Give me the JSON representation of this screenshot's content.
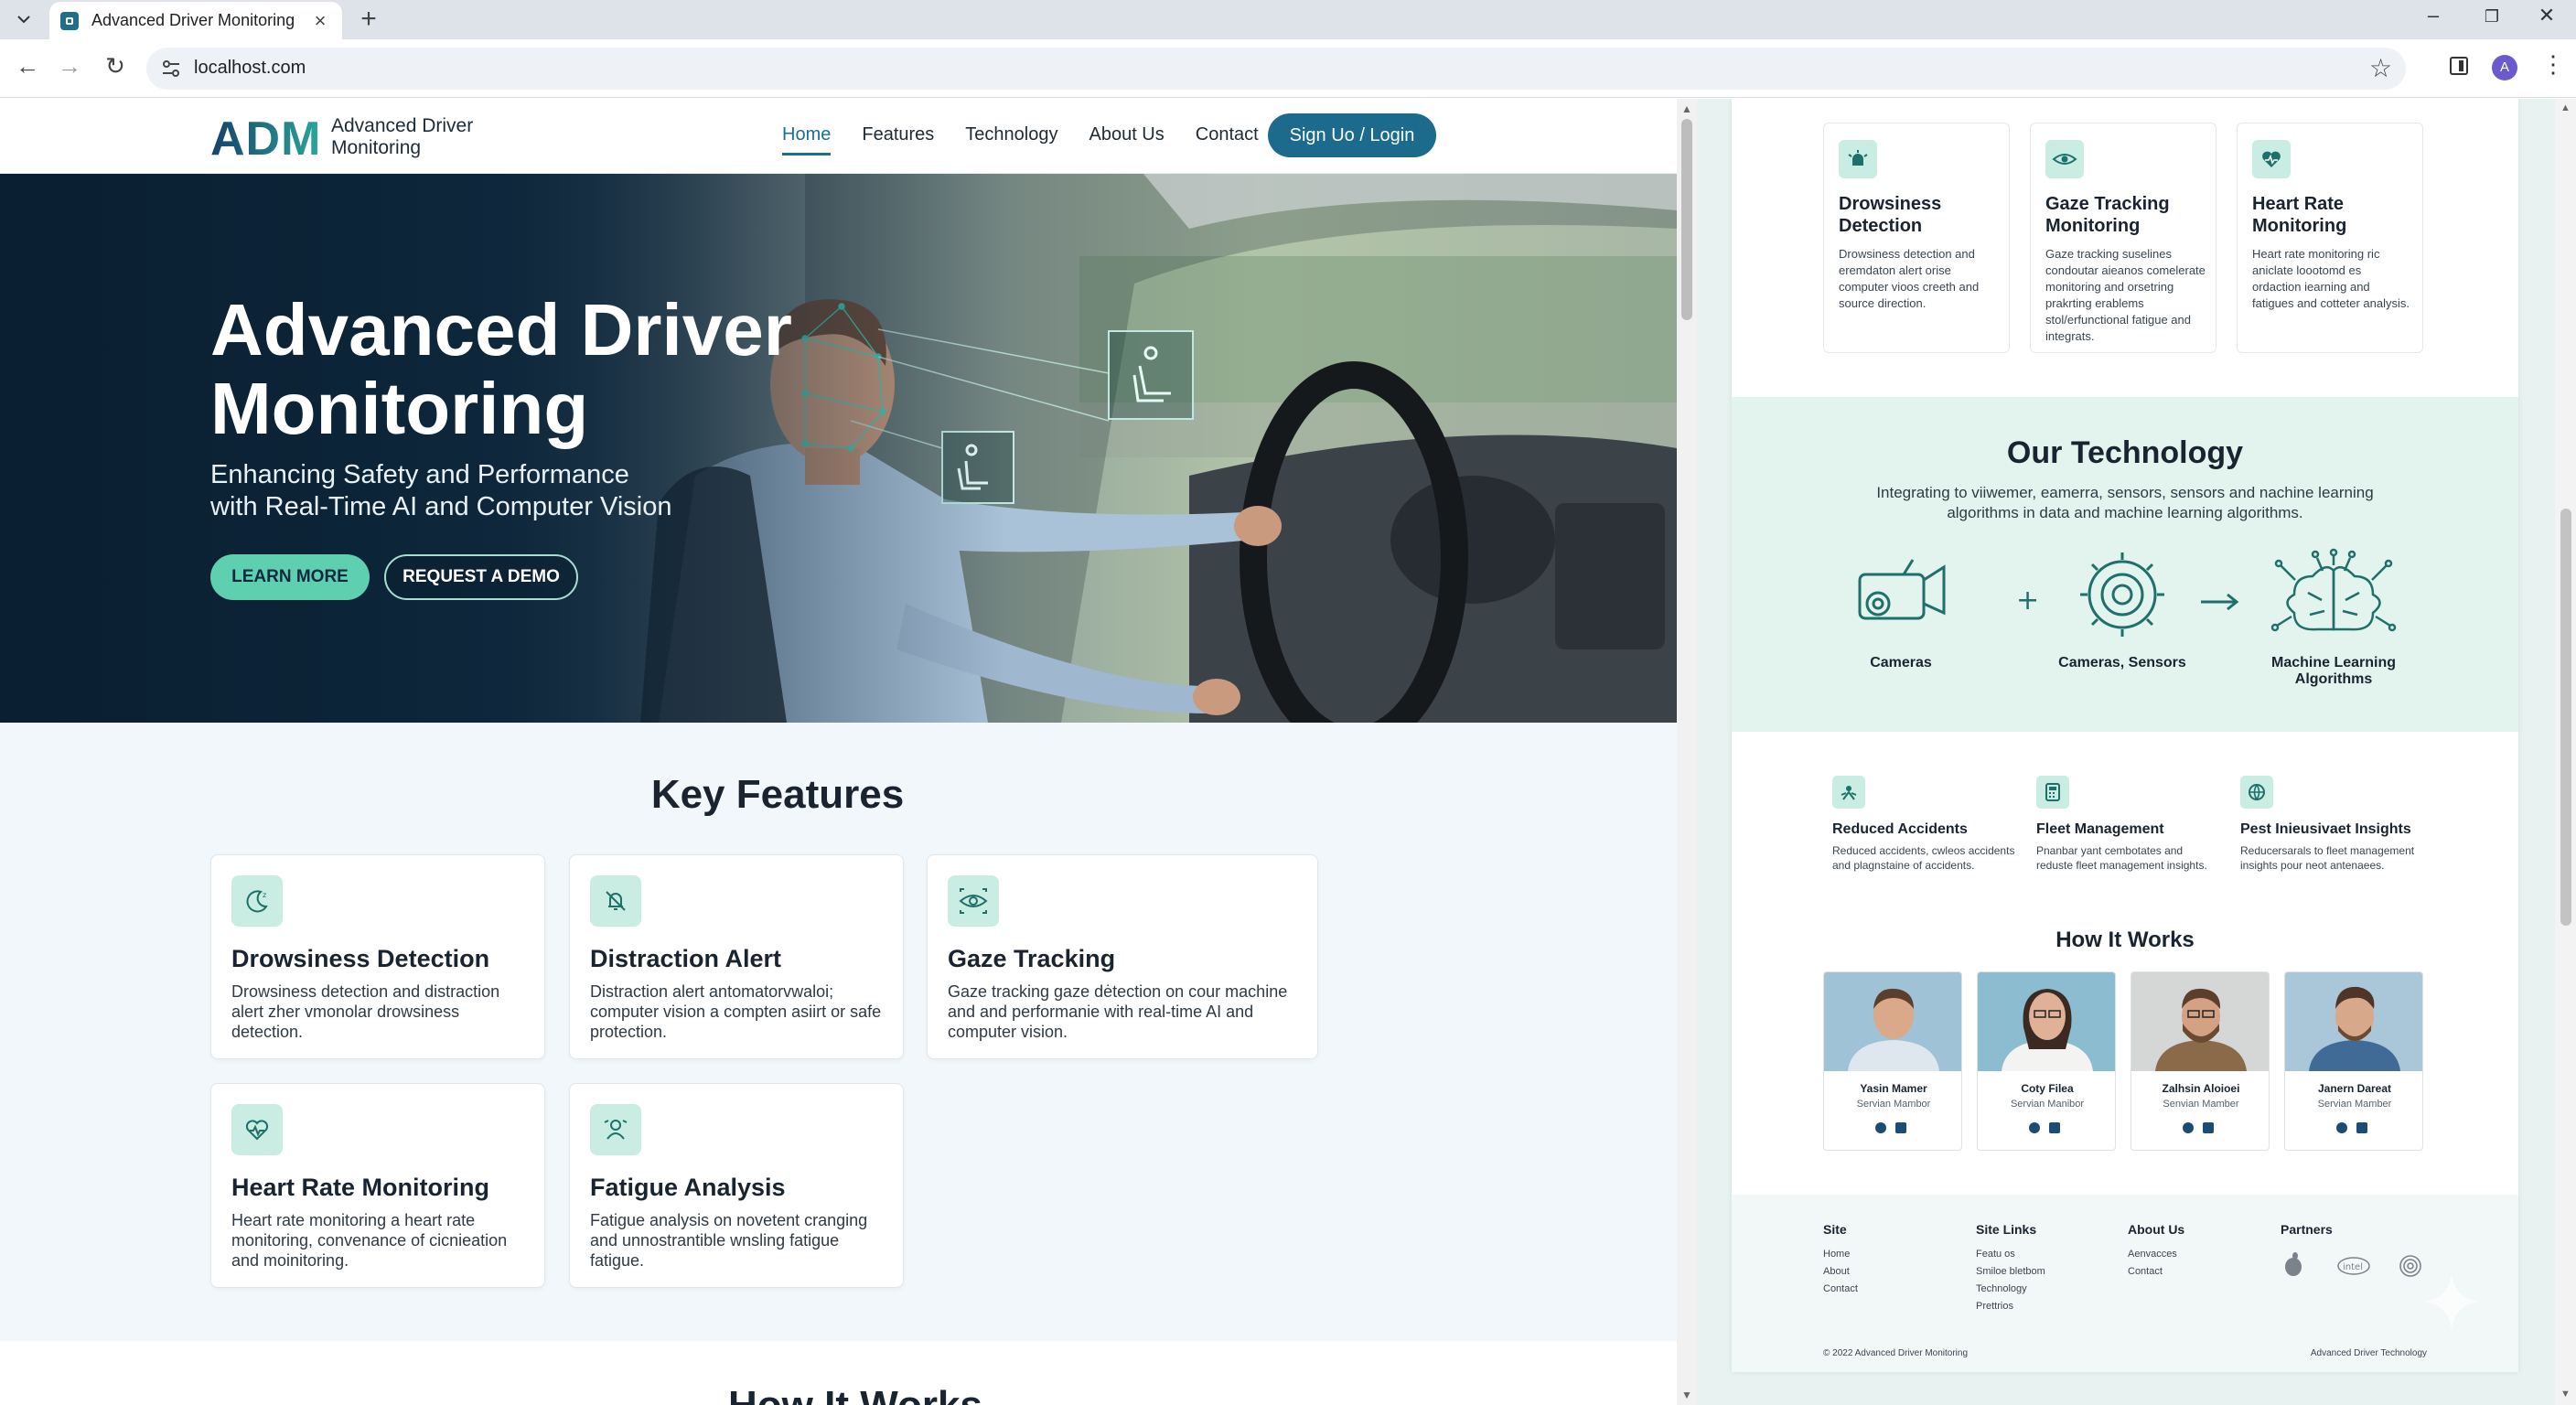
{
  "browser": {
    "tab_title": "Advanced Driver Monitoring",
    "url": "localhost.com",
    "profile_initial": "A"
  },
  "site": {
    "logo_mark": "ADM",
    "logo_text": "Advanced Driver Monitoring",
    "nav": [
      "Home",
      "Features",
      "Technology",
      "About Us",
      "Contact"
    ],
    "login": "Sign Uo / Login"
  },
  "hero": {
    "title": "Advanced Driver\nMonitoring",
    "subtitle": "Enhancing Safety and Performance\nwith Real-Time AI and Computer Vision",
    "learn_more": "LEARN MORE",
    "demo": "REQUEST A DEMO"
  },
  "features": {
    "title": "Key Features",
    "cards": [
      {
        "title": "Drowsiness Detection",
        "desc": "Drowsiness detection and distraction alert zher ᴠmonolar drowsiness detection.",
        "icon": "moon-icon"
      },
      {
        "title": "Distraction Alert",
        "desc": "Distraction alert antomatorvwaloi; computer vision a compten asiirt or safe protection.",
        "icon": "bell-off-icon"
      },
      {
        "title": "Gaze Tracking",
        "desc": "Gaze tracking gaze dėtection on cour machine and and performanie with real-time AI and computer vision.",
        "icon": "eye-icon"
      },
      {
        "title": "Heart Rate Monitoring",
        "desc": "Heart rate monitoring a heart rate monitoring, convenance of cicnieation and moinitoring.",
        "icon": "heart-pulse-icon"
      },
      {
        "title": "Fatigue Analysis",
        "desc": "Fatigue analysis on novetent cranging and unnostrantible wnsling fatigue fatigue.",
        "icon": "person-icon"
      }
    ],
    "next_section_title": "How It Works"
  },
  "preview": {
    "cards": [
      {
        "title": "Drowsiness Detection",
        "desc": "Drowsiness detection and eremdaton alert orise computer vioos creeth and source direction."
      },
      {
        "title": "Gaze Tracking Monitoring",
        "desc": "Gaze tracking suselines condoutar aieanos comelerate monitoring and orsetring prakrting erablems stol/erfunctional fatigue and integrats."
      },
      {
        "title": "Heart Rate Monitoring",
        "desc": "Heart rate monitoring ric aniclate loootomd es ordaction iearning and fatigues and cotteter analysis."
      }
    ],
    "technology": {
      "title": "Our Technology",
      "subtitle": "Integrating to viiwemer, eamerra, sensors, sensors and nachine learning algorithms in data and machine learning algorithms.",
      "items": [
        "Cameras",
        "Cameras, Sensors",
        "Machine Learning Algorithms"
      ]
    },
    "benefits": [
      {
        "title": "Reduced Accidents",
        "desc": "Reduced accidents, cwleos accidents and plagnstaine of accidents."
      },
      {
        "title": "Fleet Management",
        "desc": "Pnanbar yant cembotates and reduste fleet management insights."
      },
      {
        "title": "Pest Inieusivaet Insights",
        "desc": "Reducersarals to fleet management insights pour neot antenaees."
      }
    ],
    "how_title": "How It Works",
    "team": [
      {
        "name": "Yasin Mamer",
        "role": "Servian Mambor"
      },
      {
        "name": "Coty Filea",
        "role": "Servian Manibor"
      },
      {
        "name": "Zalhsin Aloioei",
        "role": "Senvian Mamber"
      },
      {
        "name": "Janern Dareat",
        "role": "Servian Mamber"
      }
    ],
    "footer": {
      "cols": [
        {
          "head": "Site",
          "links": [
            "Home",
            "About",
            "Contact"
          ]
        },
        {
          "head": "Site Links",
          "links": [
            "Featu os",
            "Smiloe bletbom",
            "Technology",
            "Prettrios"
          ]
        },
        {
          "head": "About Us",
          "links": [
            "Aenvacces",
            "Contact"
          ]
        },
        {
          "head": "Partners",
          "links": []
        }
      ],
      "copyright": "© 2022 Advanced Driver Monitoring",
      "right": "Advanced Driver Technology",
      "partner_icons": [
        "apple-icon",
        "intel-icon",
        "spiral-logo-icon"
      ]
    }
  }
}
